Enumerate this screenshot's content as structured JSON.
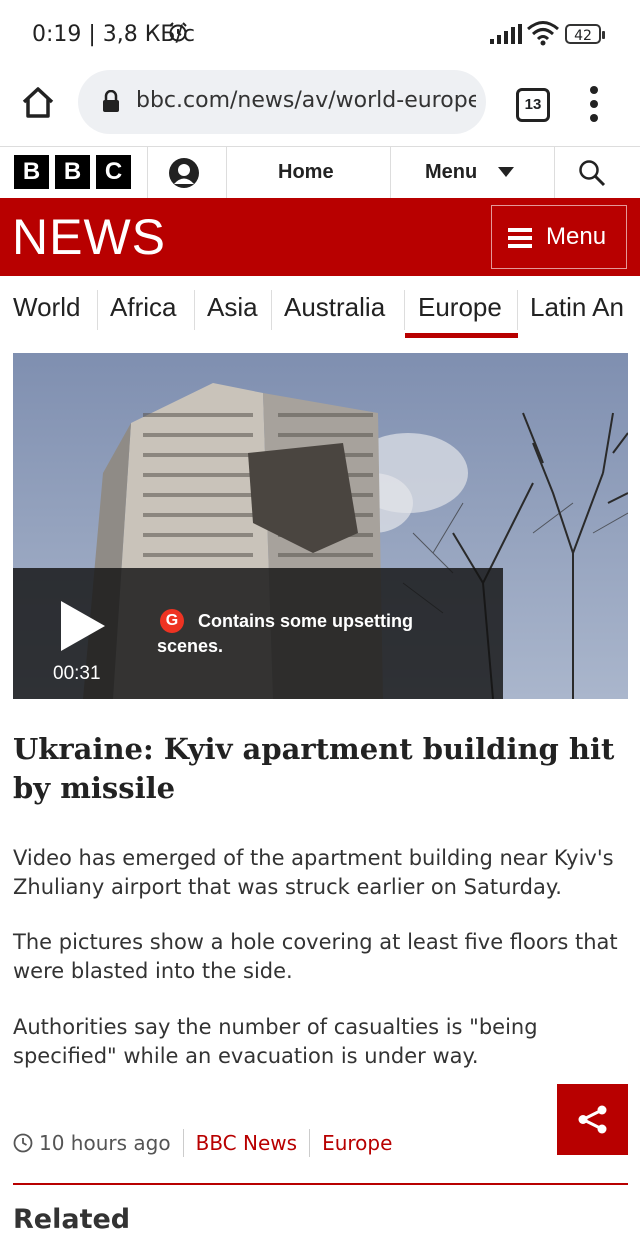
{
  "status_bar": {
    "time": "0:19 | 3,8 КБ/с",
    "battery": "42"
  },
  "browser": {
    "url": "bbc.com/news/av/world-europe-60",
    "tab_count": "13"
  },
  "bbc_bar": {
    "logo_letters": [
      "B",
      "B",
      "C"
    ],
    "home_label": "Home",
    "menu_label": "Menu"
  },
  "news_banner": {
    "wordmark": "NEWS",
    "menu_label": "Menu"
  },
  "section_nav": {
    "items": [
      "World",
      "Africa",
      "Asia",
      "Australia",
      "Europe",
      "Latin An"
    ],
    "active": "Europe"
  },
  "video": {
    "warning_badge": "G",
    "warning_text": "Contains some upsetting scenes.",
    "duration": "00:31"
  },
  "article": {
    "headline": "Ukraine: Kyiv apartment building hit by missile",
    "paragraphs": [
      "Video has emerged of the apartment building near Kyiv's Zhuliany airport that was struck earlier on Saturday.",
      "The pictures show a hole covering at least five floors that were blasted into the side.",
      "Authorities say the number of casualties is \"being specified\" while an evacuation is under way."
    ],
    "time_ago": "10 hours ago",
    "source_link": "BBC News",
    "section_link": "Europe"
  },
  "related_heading": "Related",
  "colors": {
    "brand_red": "#b80000",
    "text": "#222222"
  }
}
